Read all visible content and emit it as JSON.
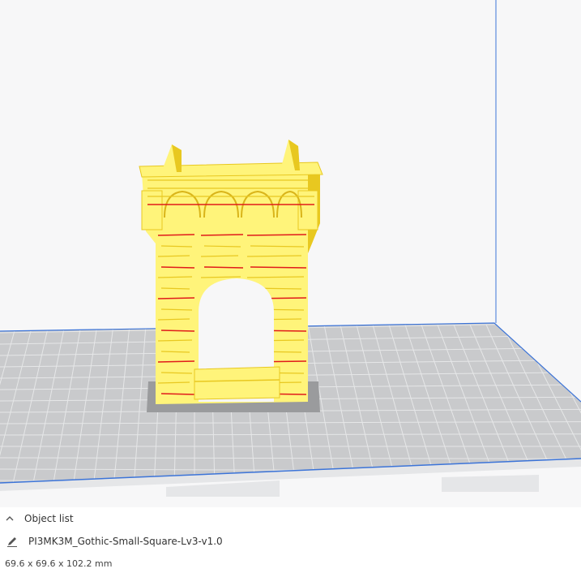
{
  "viewport": {
    "colors": {
      "background": "#f7f7f8",
      "build_plate": "#c9cacc",
      "grid_line": "#e6e7e8",
      "plate_edge": "#3c74d8",
      "build_volume_line": "#3c74d8",
      "model": "#fff47a",
      "model_shadow": "#e8c820",
      "overhang": "#e01b1b",
      "model_footprint": "#9a9b9d"
    },
    "icons": {
      "model": "gothic-arch-model-icon"
    }
  },
  "object_panel": {
    "header_label": "Object list",
    "object_name": "PI3MK3M_Gothic-Small-Square-Lv3-v1.0",
    "dimensions": "69.6 x 69.6 x 102.2 mm",
    "icons": {
      "header": "chevron-up-icon",
      "object": "pencil-icon"
    }
  }
}
